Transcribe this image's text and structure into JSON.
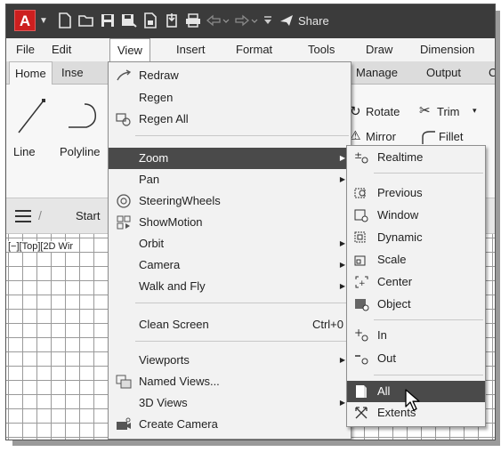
{
  "app": {
    "logo_letter": "A",
    "share_label": "Share"
  },
  "menubar": {
    "items": [
      "File",
      "Edit",
      "View",
      "Insert",
      "Format",
      "Tools",
      "Draw",
      "Dimension"
    ]
  },
  "ribbon": {
    "tabs": [
      "Home",
      "Inse",
      "Manage",
      "Output",
      "C"
    ],
    "tools": {
      "line": "Line",
      "polyline": "Polyline",
      "rotate": "Rotate",
      "trim": "Trim",
      "mirror": "Mirror",
      "fillet": "Fillet"
    }
  },
  "filetabs": {
    "start": "Start"
  },
  "viewport": {
    "label": "[−][Top][2D Wir"
  },
  "view_menu": {
    "items": [
      {
        "label": "Redraw",
        "icon": "redraw-icon"
      },
      {
        "label": "Regen"
      },
      {
        "label": "Regen All",
        "icon": "regen-all-icon"
      },
      {
        "label": "Zoom",
        "submenu": true,
        "highlighted": true
      },
      {
        "label": "Pan",
        "submenu": true
      },
      {
        "label": "SteeringWheels",
        "icon": "steering-wheels-icon"
      },
      {
        "label": "ShowMotion",
        "icon": "showmotion-icon"
      },
      {
        "label": "Orbit",
        "submenu": true
      },
      {
        "label": "Camera",
        "submenu": true
      },
      {
        "label": "Walk and Fly",
        "submenu": true
      },
      {
        "label": "Clean Screen",
        "shortcut": "Ctrl+0"
      },
      {
        "label": "Viewports",
        "submenu": true
      },
      {
        "label": "Named Views...",
        "icon": "named-views-icon"
      },
      {
        "label": "3D Views",
        "submenu": true
      },
      {
        "label": "Create Camera",
        "icon": "create-camera-icon"
      }
    ]
  },
  "zoom_menu": {
    "items": [
      {
        "label": "Realtime",
        "icon": "zoom-realtime-icon"
      },
      {
        "label": "Previous",
        "icon": "zoom-previous-icon"
      },
      {
        "label": "Window",
        "icon": "zoom-window-icon"
      },
      {
        "label": "Dynamic",
        "icon": "zoom-dynamic-icon"
      },
      {
        "label": "Scale",
        "icon": "zoom-scale-icon"
      },
      {
        "label": "Center",
        "icon": "zoom-center-icon"
      },
      {
        "label": "Object",
        "icon": "zoom-object-icon"
      },
      {
        "label": "In",
        "icon": "zoom-in-icon"
      },
      {
        "label": "Out",
        "icon": "zoom-out-icon"
      },
      {
        "label": "All",
        "icon": "zoom-all-icon",
        "highlighted": true
      },
      {
        "label": "Extents",
        "icon": "zoom-extents-icon"
      }
    ]
  }
}
